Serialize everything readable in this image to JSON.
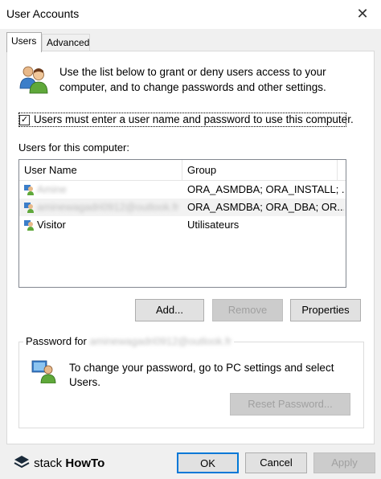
{
  "window": {
    "title": "User Accounts",
    "close_icon": "✕"
  },
  "tabs": [
    {
      "label": "Users",
      "active": true
    },
    {
      "label": "Advanced",
      "active": false
    }
  ],
  "intro": {
    "icon": "users-group-icon",
    "text": "Use the list below to grant or deny users access to your computer, and to change passwords and other settings."
  },
  "require_login": {
    "checked": true,
    "label": "Users must enter a user name and password to use this computer."
  },
  "users_list": {
    "label": "Users for this computer:",
    "columns": [
      "User Name",
      "Group"
    ],
    "rows": [
      {
        "name": "Amine",
        "group": "ORA_ASMDBA; ORA_INSTALL; ...",
        "selected": false,
        "redacted": true
      },
      {
        "name": "aminewagadri0912@outlook.fr",
        "group": "ORA_ASMDBA; ORA_DBA; OR...",
        "selected": true,
        "redacted": true
      },
      {
        "name": "Visitor",
        "group": "Utilisateurs",
        "selected": false,
        "redacted": false
      }
    ]
  },
  "buttons": {
    "add": "Add...",
    "remove": "Remove",
    "properties": "Properties",
    "reset_password": "Reset Password...",
    "ok": "OK",
    "cancel": "Cancel",
    "apply": "Apply"
  },
  "password_group": {
    "legend_prefix": "Password for",
    "legend_user": "aminewagadri0912@outlook.fr",
    "text": "To change your password, go to PC settings and select Users."
  },
  "watermark": {
    "brand_a": "stack",
    "brand_b": "HowTo"
  },
  "colors": {
    "accent": "#0078d7",
    "disabled_bg": "#cccccc",
    "selected_row": "#f2f2f2"
  }
}
